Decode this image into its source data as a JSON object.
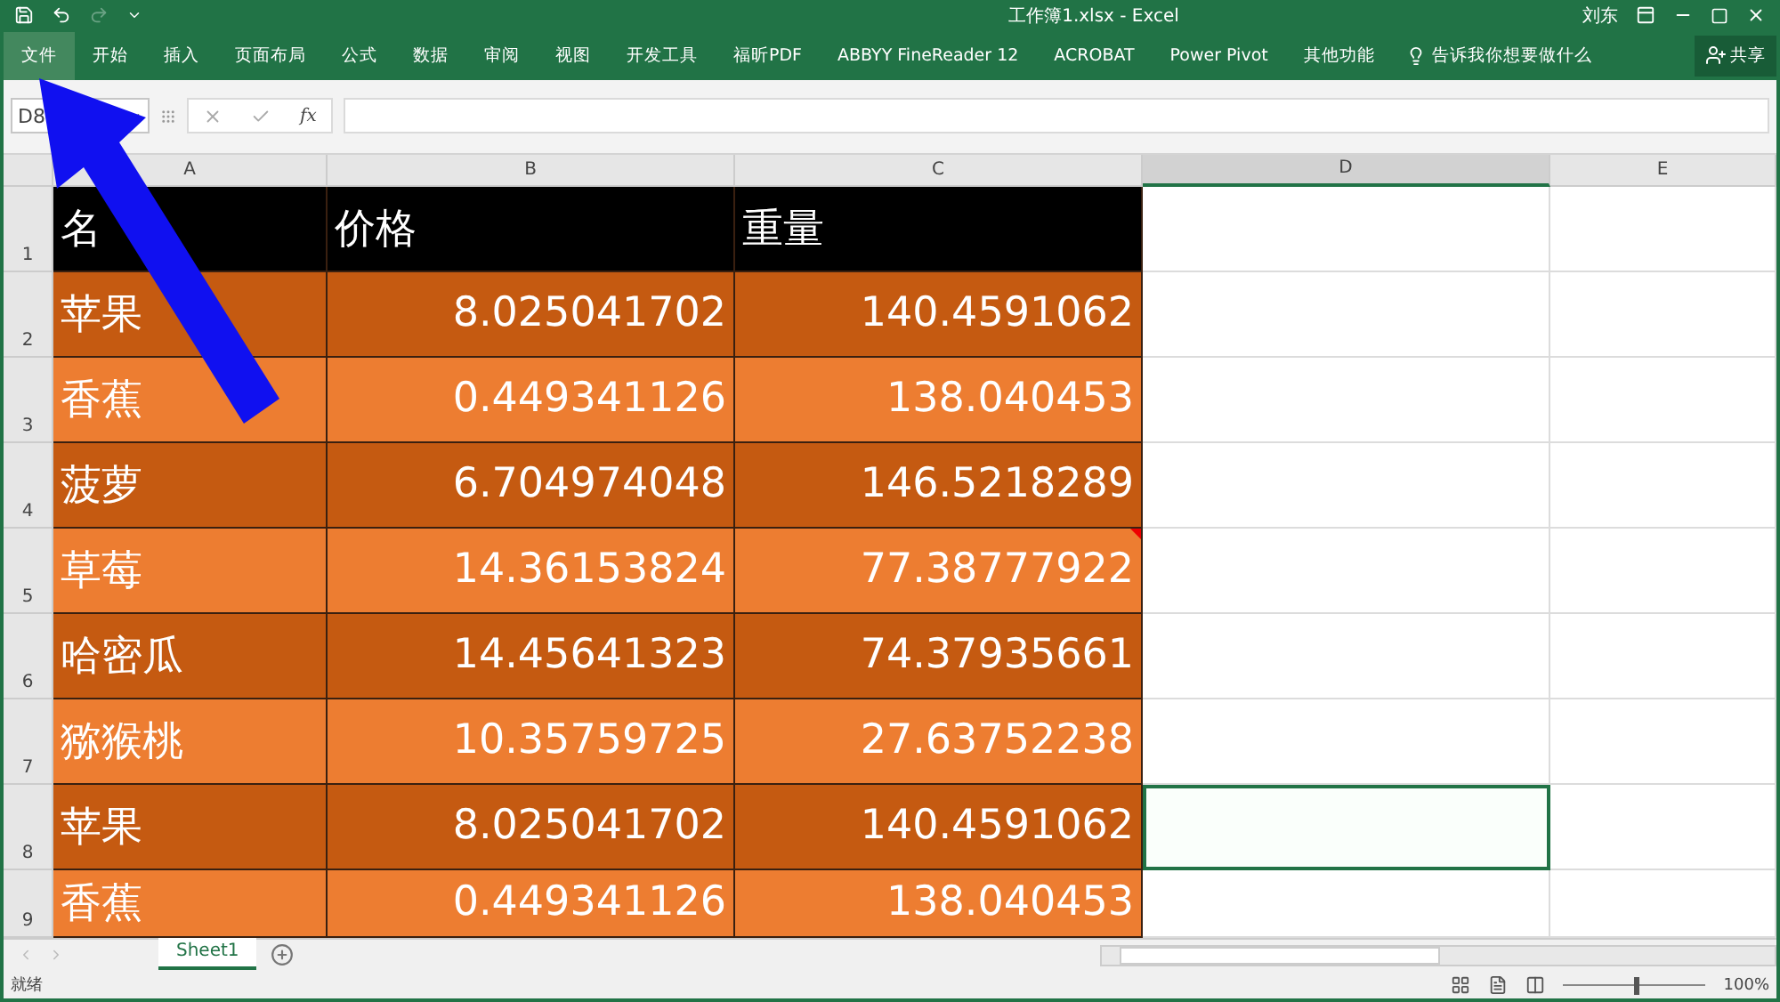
{
  "window": {
    "title": "工作簿1.xlsx  -  Excel",
    "user": "刘东"
  },
  "ribbon_tabs": [
    {
      "label": "文件",
      "selected": true
    },
    {
      "label": "开始",
      "selected": false
    },
    {
      "label": "插入",
      "selected": false
    },
    {
      "label": "页面布局",
      "selected": false
    },
    {
      "label": "公式",
      "selected": false
    },
    {
      "label": "数据",
      "selected": false
    },
    {
      "label": "审阅",
      "selected": false
    },
    {
      "label": "视图",
      "selected": false
    },
    {
      "label": "开发工具",
      "selected": false
    },
    {
      "label": "福昕PDF",
      "selected": false
    },
    {
      "label": "ABBYY FineReader 12",
      "selected": false
    },
    {
      "label": "ACROBAT",
      "selected": false
    },
    {
      "label": "Power Pivot",
      "selected": false
    },
    {
      "label": "其他功能",
      "selected": false
    }
  ],
  "tell_me": {
    "placeholder": "告诉我你想要做什么"
  },
  "share_button": "共享",
  "name_box": "D8",
  "formula_bar": {
    "fx": "fx"
  },
  "columns": [
    {
      "label": "A",
      "selected": false
    },
    {
      "label": "B",
      "selected": false
    },
    {
      "label": "C",
      "selected": false
    },
    {
      "label": "D",
      "selected": true
    },
    {
      "label": "E",
      "selected": false
    }
  ],
  "rows": [
    {
      "number": "1",
      "kind": "header",
      "cells": [
        "名",
        "价格",
        "重量"
      ],
      "d_selected": false,
      "comment": false
    },
    {
      "number": "2",
      "kind": "dark",
      "cells": [
        "苹果",
        "8.025041702",
        "140.4591062"
      ],
      "d_selected": false,
      "comment": false
    },
    {
      "number": "3",
      "kind": "light",
      "cells": [
        "香蕉",
        "0.449341126",
        "138.040453"
      ],
      "d_selected": false,
      "comment": false
    },
    {
      "number": "4",
      "kind": "dark",
      "cells": [
        "菠萝",
        "6.704974048",
        "146.5218289"
      ],
      "d_selected": false,
      "comment": false
    },
    {
      "number": "5",
      "kind": "light",
      "cells": [
        "草莓",
        "14.36153824",
        "77.38777922"
      ],
      "d_selected": false,
      "comment": true
    },
    {
      "number": "6",
      "kind": "dark",
      "cells": [
        "哈密瓜",
        "14.45641323",
        "74.37935661"
      ],
      "d_selected": false,
      "comment": false
    },
    {
      "number": "7",
      "kind": "light",
      "cells": [
        "猕猴桃",
        "10.35759725",
        "27.63752238"
      ],
      "d_selected": false,
      "comment": false
    },
    {
      "number": "8",
      "kind": "dark",
      "cells": [
        "苹果",
        "8.025041702",
        "140.4591062"
      ],
      "d_selected": true,
      "comment": false
    },
    {
      "number": "9",
      "kind": "light",
      "cells": [
        "香蕉",
        "0.449341126",
        "138.040453"
      ],
      "d_selected": false,
      "comment": false
    }
  ],
  "sheet_tabs": [
    {
      "label": "Sheet1",
      "selected": true
    }
  ],
  "status_bar": {
    "text": "就绪",
    "zoom": {
      "level": 0.5,
      "reading": "100%"
    }
  }
}
